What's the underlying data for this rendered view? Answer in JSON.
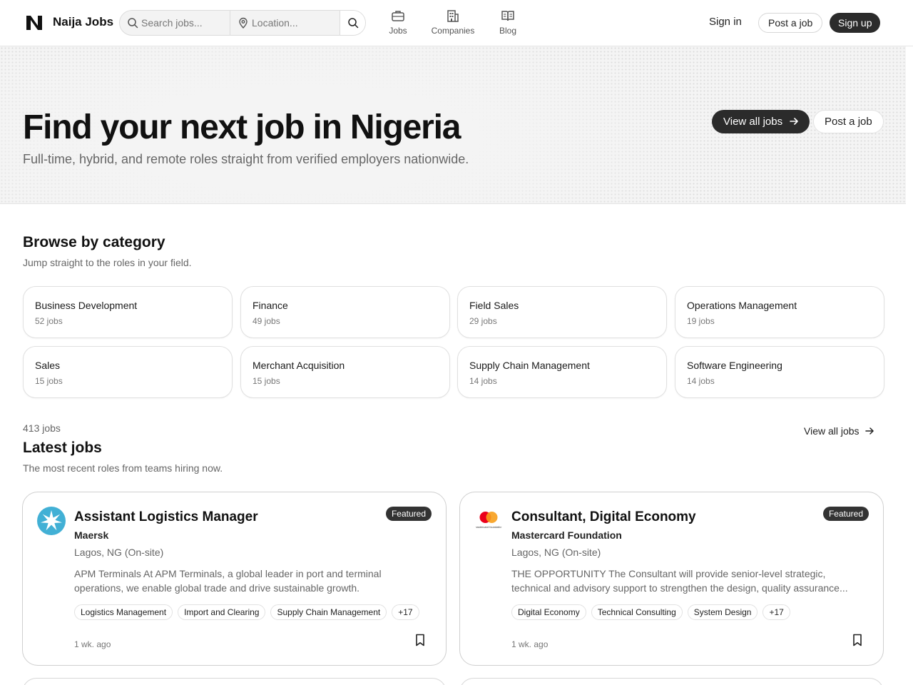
{
  "brand": {
    "name": "Naija Jobs"
  },
  "search": {
    "query_placeholder": "Search jobs...",
    "location_placeholder": "Location..."
  },
  "nav": {
    "items": [
      {
        "label": "Jobs",
        "icon": "briefcase-icon"
      },
      {
        "label": "Companies",
        "icon": "building-icon"
      },
      {
        "label": "Blog",
        "icon": "book-open-icon"
      }
    ],
    "sign_in": "Sign in",
    "post_job": "Post a job",
    "sign_up": "Sign up"
  },
  "hero": {
    "title": "Find your next job in Nigeria",
    "subtitle": "Full-time, hybrid, and remote roles straight from verified employers nationwide.",
    "view_all": "View all jobs",
    "post_job": "Post a job"
  },
  "categories": {
    "title": "Browse by category",
    "subtitle": "Jump straight to the roles in your field.",
    "items": [
      {
        "name": "Business Development",
        "count": "52 jobs"
      },
      {
        "name": "Finance",
        "count": "49 jobs"
      },
      {
        "name": "Field Sales",
        "count": "29 jobs"
      },
      {
        "name": "Operations Management",
        "count": "19 jobs"
      },
      {
        "name": "Sales",
        "count": "15 jobs"
      },
      {
        "name": "Merchant Acquisition",
        "count": "15 jobs"
      },
      {
        "name": "Supply Chain Management",
        "count": "14 jobs"
      },
      {
        "name": "Software Engineering",
        "count": "14 jobs"
      }
    ]
  },
  "jobs": {
    "count": "413 jobs",
    "title": "Latest jobs",
    "subtitle": "The most recent roles from teams hiring now.",
    "view_all": "View all jobs",
    "items": [
      {
        "title": "Assistant Logistics Manager",
        "company": "Maersk",
        "location": "Lagos, NG (On-site)",
        "description": "APM Terminals At APM Terminals, a global leader in port and terminal operations, we enable global trade and drive sustainable growth.",
        "badge": "Featured",
        "tags": [
          "Logistics Management",
          "Import and Clearing",
          "Supply Chain Management"
        ],
        "more": "+17",
        "time": "1 wk. ago",
        "logo": "maersk-star-logo"
      },
      {
        "title": "Consultant, Digital Economy",
        "company": "Mastercard Foundation",
        "location": "Lagos, NG (On-site)",
        "description": "THE OPPORTUNITY The Consultant will provide senior-level strategic, technical and advisory support to strengthen the design, quality assurance...",
        "badge": "Featured",
        "tags": [
          "Digital Economy",
          "Technical Consulting",
          "System Design"
        ],
        "more": "+17",
        "time": "1 wk. ago",
        "logo": "mastercard-foundation-logo",
        "logo_text": "mastercard foundation"
      }
    ]
  },
  "colors": {
    "accent_dark": "#2b2b2b",
    "maersk_blue": "#42b0d5",
    "mc_red": "#eb001b",
    "mc_orange": "#f79e1b"
  }
}
